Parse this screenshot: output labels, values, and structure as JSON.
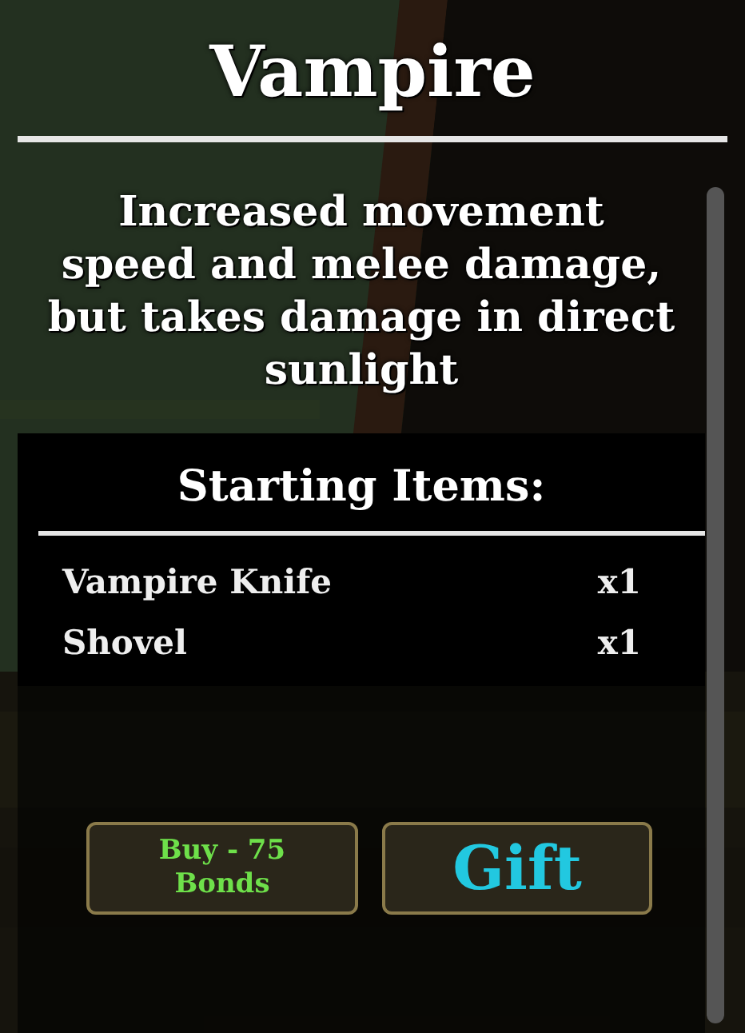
{
  "title": "Vampire",
  "description": "Increased movement speed and melee damage, but takes damage in direct sunlight",
  "starting_items": {
    "heading": "Starting Items:",
    "items": [
      {
        "name": "Vampire Knife",
        "quantity": "x1"
      },
      {
        "name": "Shovel",
        "quantity": "x1"
      }
    ]
  },
  "buttons": [
    {
      "kind": "buy",
      "label": "Buy - 75 Bonds"
    },
    {
      "kind": "gift",
      "label": "Gift"
    }
  ]
}
